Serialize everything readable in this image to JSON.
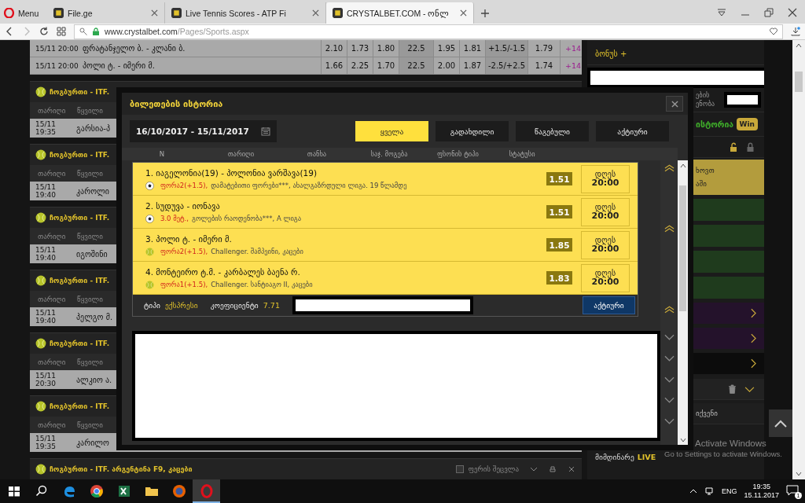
{
  "browser": {
    "tabs": [
      {
        "kind": "menu",
        "label": "Menu",
        "selected": false
      },
      {
        "kind": "page",
        "label": "File.ge",
        "selected": false
      },
      {
        "kind": "page",
        "label": "Live Tennis Scores - ATP Fi",
        "selected": false
      },
      {
        "kind": "page",
        "label": "CRYSTALBET.COM - ონლ",
        "selected": true
      }
    ],
    "address": {
      "domain": "www.crystalbet.com",
      "path": "/Pages/Sports.aspx"
    }
  },
  "top_matches": [
    {
      "date": "15/11 20:00",
      "pair": "ფრატანჯელო ბ. - კლანი ბ.",
      "cells": [
        {
          "text": "2.10",
          "kind": "odd"
        },
        {
          "text": "1.73",
          "kind": "odd"
        },
        {
          "text": "1.80",
          "kind": "odd"
        },
        {
          "text": "22.5",
          "kind": "line"
        },
        {
          "text": "1.95",
          "kind": "odd"
        },
        {
          "text": "1.81",
          "kind": "odd"
        },
        {
          "text": "+1.5/-1.5",
          "kind": "line"
        },
        {
          "text": "1.79",
          "kind": "odd"
        },
        {
          "text": "+14",
          "kind": "more"
        }
      ]
    },
    {
      "date": "15/11 20:00",
      "pair": "პოლი ტ. - იმერი მ.",
      "cells": [
        {
          "text": "1.66",
          "kind": "odd"
        },
        {
          "text": "2.25",
          "kind": "odd"
        },
        {
          "text": "1.70",
          "kind": "odd"
        },
        {
          "text": "22.5",
          "kind": "line"
        },
        {
          "text": "2.00",
          "kind": "odd"
        },
        {
          "text": "1.87",
          "kind": "odd"
        },
        {
          "text": "-2.5/+2.5",
          "kind": "line"
        },
        {
          "text": "1.74",
          "kind": "odd"
        },
        {
          "text": "+14",
          "kind": "more"
        }
      ]
    }
  ],
  "leagues": [
    {
      "title": "ჩოგბურთი - ITF.",
      "columns": [
        "თარიღი",
        "წყვილი"
      ],
      "date": "15/11 19:35",
      "pair": "გარსია-პ"
    },
    {
      "title": "ჩოგბურთი - ITF.",
      "columns": [
        "თარიღი",
        "წყვილი"
      ],
      "date": "15/11 19:40",
      "pair": "კაროლი"
    },
    {
      "title": "ჩოგბურთი - ITF.",
      "columns": [
        "თარიღი",
        "წყვილი"
      ],
      "date": "15/11 19:40",
      "pair": "იგოშინი"
    },
    {
      "title": "ჩოგბურთი - ITF.",
      "columns": [
        "თარიღი",
        "წყვილი"
      ],
      "date": "15/11 19:40",
      "pair": "პელგო მ."
    },
    {
      "title": "ჩოგბურთი - ITF.",
      "columns": [
        "თარიღი",
        "წყვილი"
      ],
      "date": "15/11 20:30",
      "pair": "ალკიო ა."
    },
    {
      "title": "ჩოგბურთი - ITF.",
      "columns": [
        "თარიღი",
        "წყვილი"
      ],
      "date": "15/11 19:35",
      "pair": "კარილო"
    }
  ],
  "bottom_league": {
    "title": "ჩოგბურთი - ITF. არგენტინა F9, კაცები",
    "color_toggle": {
      "label": "ფერის შეცვლა",
      "checked": false
    }
  },
  "modal": {
    "title": "ბილეთების ისტორია",
    "date_range": "16/10/2017 - 15/11/2017",
    "filters": [
      {
        "label": "ყველა",
        "selected": true
      },
      {
        "label": "გადახდილი",
        "selected": false
      },
      {
        "label": "წაგებული",
        "selected": false
      },
      {
        "label": "აქტიური",
        "selected": false
      }
    ],
    "columns": [
      "N",
      "თარიღი",
      "თანხა",
      "საჯ. მოგება",
      "ფსონის ტიპი",
      "სტატუსი"
    ],
    "ticket": {
      "bets": [
        {
          "title": "1. იაგელონია(19) - პოლონია ვარშავა(19)",
          "kind": "football",
          "pick": "ფორა2(+1.5),",
          "details": "დამატებითი ფორები***, ახალგაზრდული ლიგა. 19 წლამდე",
          "odds": "1.51",
          "day": "დღეს",
          "time": "20:00"
        },
        {
          "title": "2. სუდუვა - იონავა",
          "kind": "football",
          "pick": "3.0 მეტ.,",
          "details": "გოლების რაოდენობა***, A ლიგა",
          "odds": "1.51",
          "day": "დღეს",
          "time": "20:00"
        },
        {
          "title": "3. პოლი ტ. - იმერი მ.",
          "kind": "tennis",
          "pick": "ფორა2(+1.5),",
          "details": "Challenger. შამპეინი, კაცები",
          "odds": "1.85",
          "day": "დღეს",
          "time": "20:00"
        },
        {
          "title": "4. მონტეირო ტ.მ. - კარბალეს ბაენა რ.",
          "kind": "tennis",
          "pick": "ფორა1(+1.5),",
          "details": "Challenger. სანტიაგო II, კაცები",
          "odds": "1.83",
          "day": "დღეს",
          "time": "20:00"
        }
      ],
      "type_label": "ტიპი",
      "type": "ექსპრესი",
      "coef_label": "კოეფიციენტი",
      "coef": "7.71",
      "status": "აქტიური"
    },
    "toggles": [
      {
        "expanded": true
      },
      {
        "expanded": true
      },
      {
        "expanded": true
      },
      {
        "expanded": false
      },
      {
        "expanded": false
      },
      {
        "expanded": false
      },
      {
        "expanded": false
      },
      {
        "expanded": false
      }
    ]
  },
  "sidebar": {
    "bonus": "ბონუს +",
    "notice_lines": [
      "ების",
      "ენობა"
    ],
    "history": "ისტორია",
    "win_badge": "Win",
    "banner_lines": [
      "ხოვთ",
      "აში"
    ],
    "promos": [
      {
        "color": "#24122b"
      },
      {
        "color": "#24122b"
      },
      {
        "color": "#0c0c0c"
      }
    ],
    "yours": "იქვენი",
    "live": {
      "label": "მიმდინარე",
      "badge": "LIVE"
    }
  },
  "os_notice": {
    "title": "Activate Windows",
    "text": "Go to Settings to activate Windows."
  },
  "taskbar": {
    "apps": [
      {
        "kind": "edge",
        "selected": false
      },
      {
        "kind": "chrome",
        "selected": false
      },
      {
        "kind": "excel",
        "selected": false
      },
      {
        "kind": "folder",
        "selected": false
      },
      {
        "kind": "firefox",
        "selected": false
      },
      {
        "kind": "opera",
        "selected": true
      }
    ],
    "language": "ENG",
    "time": "19:35",
    "date": "15.11.2017",
    "notifications": "1"
  }
}
